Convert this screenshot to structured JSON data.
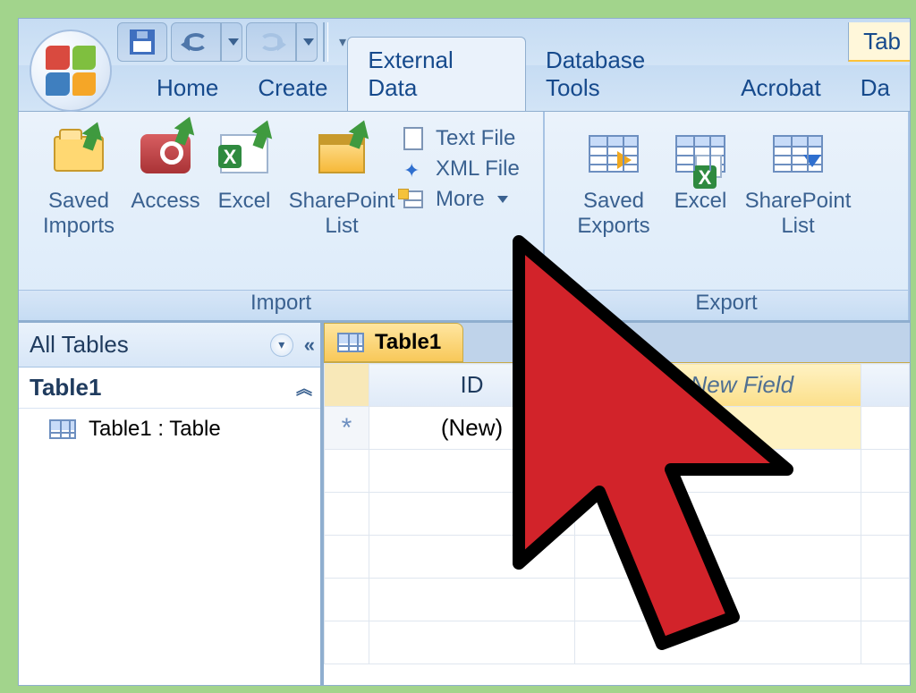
{
  "qat": {
    "save": "Save",
    "undo": "Undo",
    "redo": "Redo"
  },
  "context_tab": "Tab",
  "tabs": {
    "home": "Home",
    "create": "Create",
    "external": "External Data",
    "database": "Database Tools",
    "acrobat": "Acrobat",
    "datasheet": "Da"
  },
  "ribbon": {
    "import": {
      "group_label": "Import",
      "saved_imports": "Saved\nImports",
      "access": "Access",
      "excel": "Excel",
      "sharepoint": "SharePoint\nList",
      "text_file": "Text File",
      "xml_file": "XML File",
      "more": "More"
    },
    "export": {
      "group_label": "Export",
      "saved_exports": "Saved\nExports",
      "excel": "Excel",
      "sharepoint": "SharePoint\nList"
    }
  },
  "nav": {
    "title": "All Tables",
    "group": "Table1",
    "object": "Table1 : Table"
  },
  "doc": {
    "tab": "Table1",
    "col_id": "ID",
    "col_add": "Add New Field",
    "new_id_placeholder": "(New)",
    "new_row_marker": "*"
  }
}
